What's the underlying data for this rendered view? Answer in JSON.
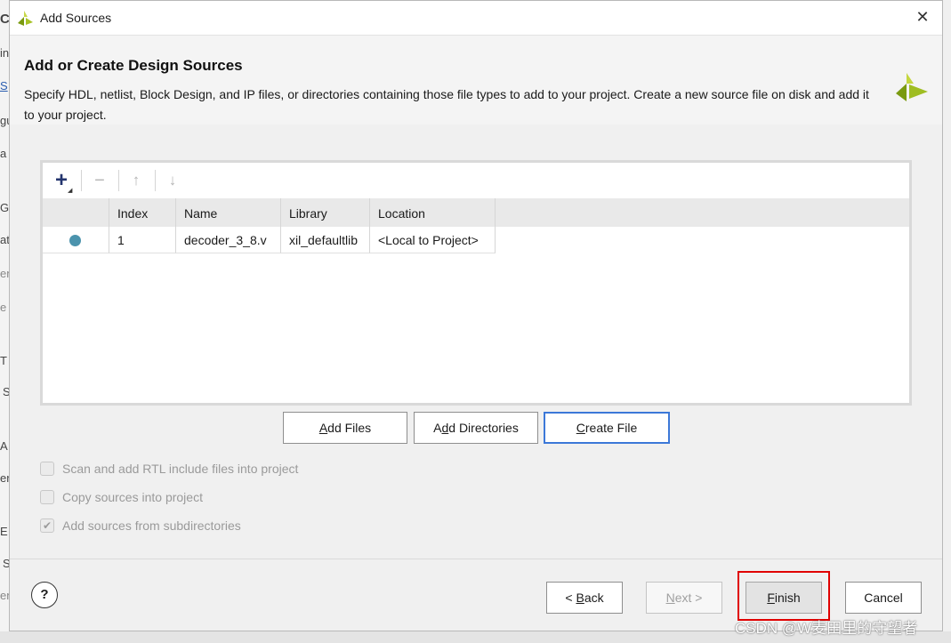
{
  "window": {
    "title": "Add Sources",
    "close_label": "✕"
  },
  "header": {
    "heading": "Add or Create Design Sources",
    "description": "Specify HDL, netlist, Block Design, and IP files, or directories containing those file types to add to your project. Create a new source file on disk and add it to your project."
  },
  "toolbar": {
    "add": "+",
    "remove": "−",
    "up": "↑",
    "down": "↓"
  },
  "table": {
    "headers": [
      "",
      "Index",
      "Name",
      "Library",
      "Location"
    ],
    "rows": [
      {
        "index": "1",
        "name": "decoder_3_8.v",
        "library": "xil_defaultlib",
        "location": "<Local to Project>"
      }
    ]
  },
  "buttons": {
    "add_files_u": "A",
    "add_files_rest": "dd Files",
    "add_dirs_pre": "A",
    "add_dirs_u": "d",
    "add_dirs_rest": "d Directories",
    "create_u": "C",
    "create_rest": "reate File",
    "back_pre": "< ",
    "back_u": "B",
    "back_rest": "ack",
    "next_u": "N",
    "next_rest": "ext >",
    "finish_u": "F",
    "finish_rest": "inish",
    "cancel": "Cancel",
    "help": "?"
  },
  "options": {
    "scan_label": "Scan and add RTL include files into project",
    "copy_label": "Copy sources into project",
    "subdirs_label": "Add sources from subdirectories",
    "scan_checked": false,
    "copy_checked": false,
    "subdirs_checked": true
  },
  "watermark": "CSDN @W麦田里的守望者",
  "colors": {
    "accent": "#3c78d8",
    "status_dot": "#4b93ad",
    "highlight": "#e00000",
    "logo": "#8dab18"
  },
  "background_app": {
    "partial_chars": [
      "C",
      "in",
      "S",
      "gu",
      "a",
      "G",
      "at",
      "en",
      "e",
      "T",
      "S",
      "A",
      "er",
      "E",
      "S",
      "en"
    ]
  }
}
